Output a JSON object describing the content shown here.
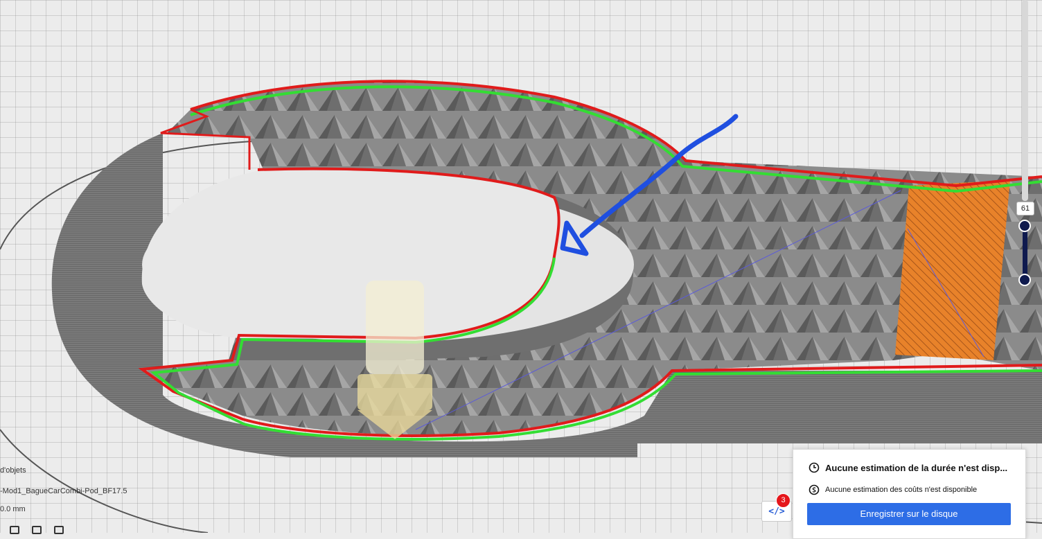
{
  "layer_view": {
    "current_layer": "61"
  },
  "object_list": {
    "header": "d'objets",
    "object_name": "-Mod1_BagueCar",
    "object_name_tail": "Combi-Pod_BF17.5",
    "dimensions": "0.0 mm"
  },
  "gcode_button": {
    "label": "</>",
    "badge_count": "3"
  },
  "output_panel": {
    "time_estimate": "Aucune estimation de la durée n'est disp...",
    "cost_estimate": "Aucune estimation des coûts n'est disponible",
    "save_button_label": "Enregistrer sur le disque"
  },
  "colors": {
    "accent": "#2d6de6",
    "layer_handle": "#0f1a4e",
    "badge": "#e5161b",
    "outer_wall": "#e01b1b",
    "inner_wall": "#33dd33",
    "skin": "#e8822a",
    "annotation": "#1f4fe0"
  },
  "icons": {
    "time": "clock-icon",
    "cost": "coin-icon",
    "gcode": "code-icon"
  }
}
